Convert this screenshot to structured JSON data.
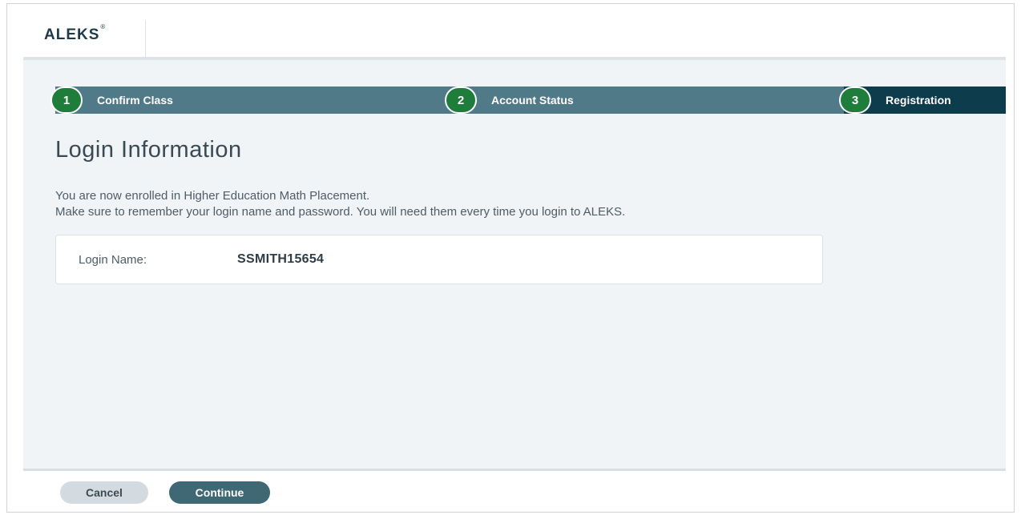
{
  "header": {
    "logo_text": "ALEKS",
    "logo_mark": "®"
  },
  "stepper": {
    "steps": [
      {
        "number": "1",
        "label": "Confirm Class"
      },
      {
        "number": "2",
        "label": "Account Status"
      },
      {
        "number": "3",
        "label": "Registration",
        "active": true
      }
    ]
  },
  "main": {
    "title": "Login Information",
    "intro_line1": "You are now enrolled in Higher Education Math Placement.",
    "intro_line2": "Make sure to remember your login name and password. You will need them every time you login to ALEKS.",
    "login_label": "Login Name:",
    "login_value": "SSMITH15654"
  },
  "footer": {
    "cancel_label": "Cancel",
    "continue_label": "Continue"
  },
  "colors": {
    "stepper_bar": "#507a87",
    "active_step": "#0d3c4d",
    "step_circle": "#1f7d3c",
    "primary_button": "#3f6774"
  }
}
